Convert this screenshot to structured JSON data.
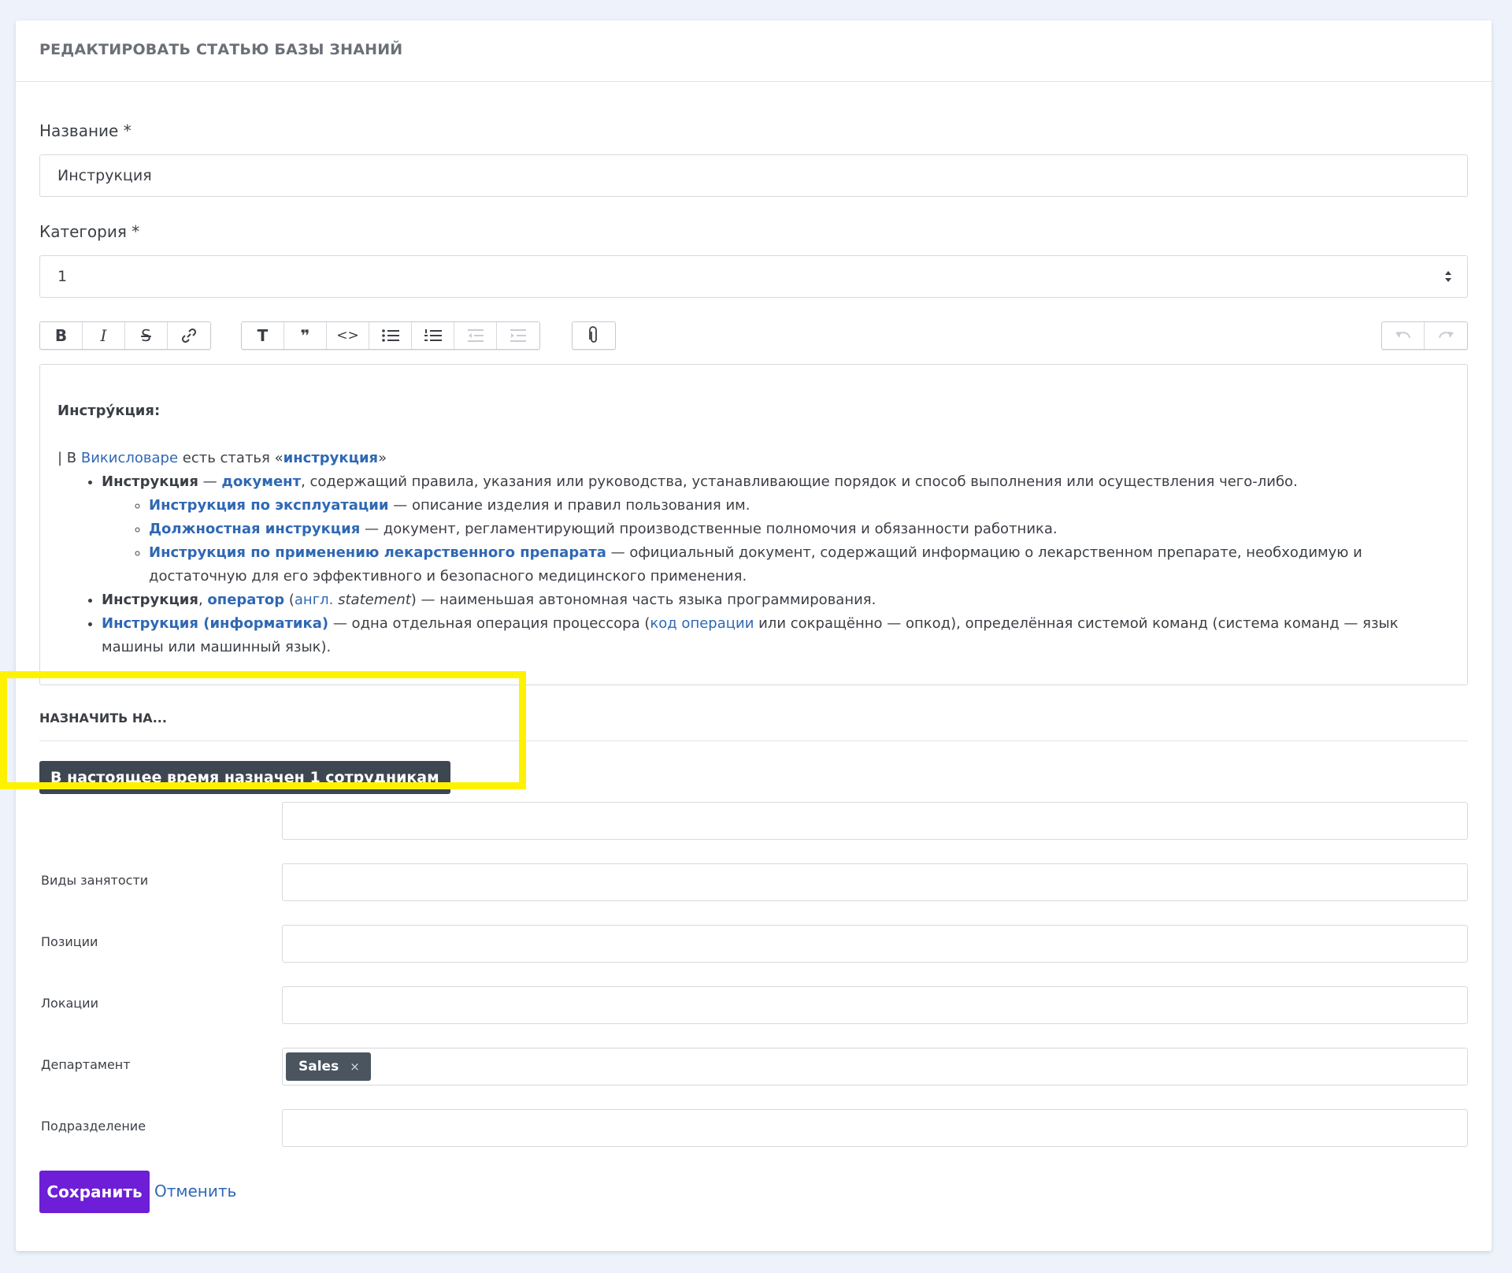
{
  "header": {
    "title": "РЕДАКТИРОВАТЬ СТАТЬЮ БАЗЫ ЗНАНИЙ"
  },
  "form": {
    "name_label": "Название *",
    "name_value": "Инструкция",
    "category_label": "Категория *",
    "category_value": "1"
  },
  "toolbar": {
    "bold": "B",
    "italic": "I",
    "strike": "S",
    "heading": "T",
    "quote": "❞",
    "code": "<>"
  },
  "editor": {
    "heading": "Инстру́кция:",
    "wiki_prefix": "| В ",
    "wiki_link": "Викисловаре",
    "wiki_mid": " есть статья «",
    "wiki_article": "инструкция",
    "wiki_end": "»",
    "li1_bold": "Инструкция",
    "li1_dash": " — ",
    "li1_link": "документ",
    "li1_text": ", содержащий правила, указания или руководства, устанавливающие порядок и способ выполнения или осуществления чего-либо.",
    "sub1_link": "Инструкция по эксплуатации",
    "sub1_text": " — описание изделия и правил пользования им.",
    "sub2_link": "Должностная инструкция",
    "sub2_text": " — документ, регламентирующий производственные полномочия и обязанности работника.",
    "sub3_link": "Инструкция по применению лекарственного препарата",
    "sub3_text": " — официальный документ, содержащий информацию о лекарственном препарате, необходимую и достаточную для его эффективного и безопасного медицинского применения.",
    "li2_bold": "Инструкция",
    "li2_comma": ", ",
    "li2_link": "оператор",
    "li2_open": " (",
    "li2_lang": "англ.",
    "li2_space": " ",
    "li2_term": "statement",
    "li2_text": ") — наименьшая автономная часть языка программирования.",
    "li3_link": "Инструкция (информатика)",
    "li3_text1": " — одна отдельная операция процессора (",
    "li3_link2": "код операции",
    "li3_text2": " или сокращённо — опкод), определённая системой команд (система команд — язык машины или машинный язык)."
  },
  "assign": {
    "title": "НАЗНАЧИТЬ НА...",
    "badge_prefix": "В настоящее время назначен ",
    "badge_count": "1",
    "badge_suffix": " сотрудникам",
    "rows": [
      {
        "label": ""
      },
      {
        "label": "Виды занятости"
      },
      {
        "label": "Позиции"
      },
      {
        "label": "Локации"
      },
      {
        "label": "Департамент",
        "tag": "Sales",
        "tag_remove": "×"
      },
      {
        "label": "Подразделение"
      }
    ]
  },
  "actions": {
    "save": "Сохранить",
    "cancel": "Отменить"
  },
  "colors": {
    "primary": "#6d1ed6",
    "link": "#2f68b4",
    "highlight": "#fff200",
    "badge": "#3d4651"
  }
}
